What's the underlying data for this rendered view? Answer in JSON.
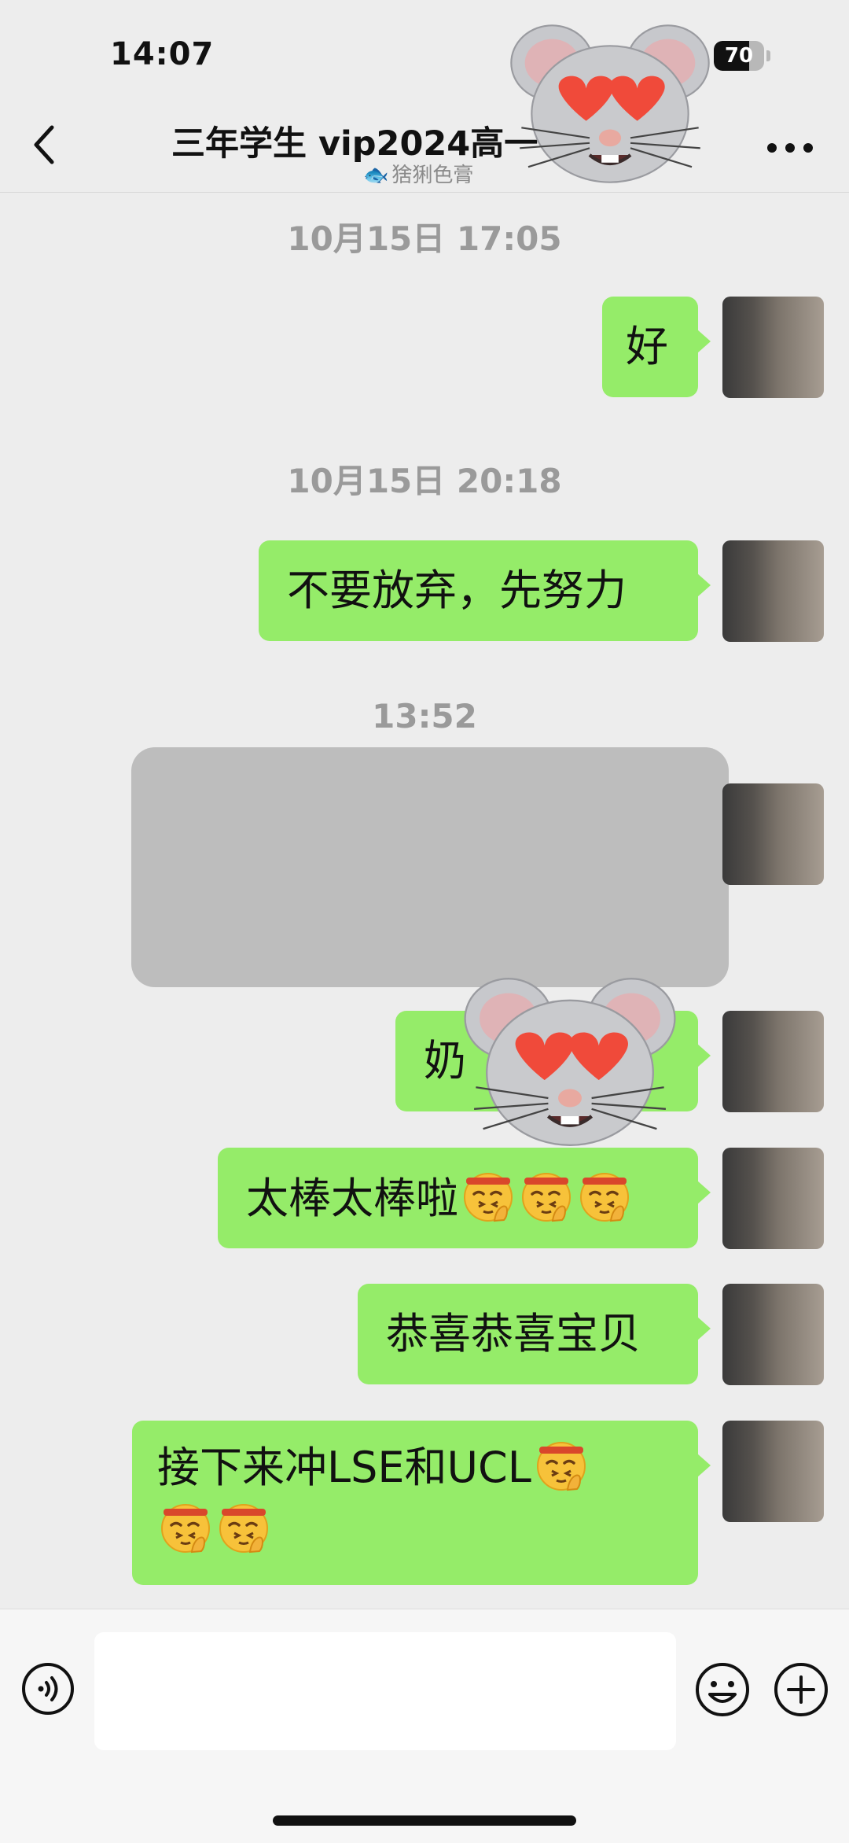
{
  "status_bar": {
    "time": "14:07",
    "battery": "70",
    "battery_level": 0.7
  },
  "header": {
    "title": "三年学生 vip2024高一",
    "subtitle": "猞猁色膏"
  },
  "messages": [
    {
      "type": "timestamp",
      "text": "10月15日 17:05"
    },
    {
      "type": "sent",
      "text": "好"
    },
    {
      "type": "timestamp",
      "text": "10月15日 20:18"
    },
    {
      "type": "sent",
      "text": "不要放弃，先努力"
    },
    {
      "type": "timestamp",
      "text": "13:52"
    },
    {
      "type": "sent",
      "redacted": true
    },
    {
      "type": "sent",
      "text": "奶"
    },
    {
      "type": "sent",
      "text": "太棒太棒啦"
    },
    {
      "type": "sent",
      "text": "恭喜恭喜宝贝"
    },
    {
      "type": "sent",
      "text": "接下来冲LSE和UCL"
    }
  ],
  "input_bar": {
    "placeholder": ""
  },
  "icons": {
    "back": "chevron-left-icon",
    "more": "more-dots-icon",
    "voice": "voice-icon",
    "emoji": "emoji-icon",
    "plus": "plus-icon",
    "salute": "saluting-face-emoji",
    "sticker": "mouse-heart-eyes-sticker"
  },
  "colors": {
    "bubble_sent": "#95ec69",
    "background": "#ededed"
  }
}
